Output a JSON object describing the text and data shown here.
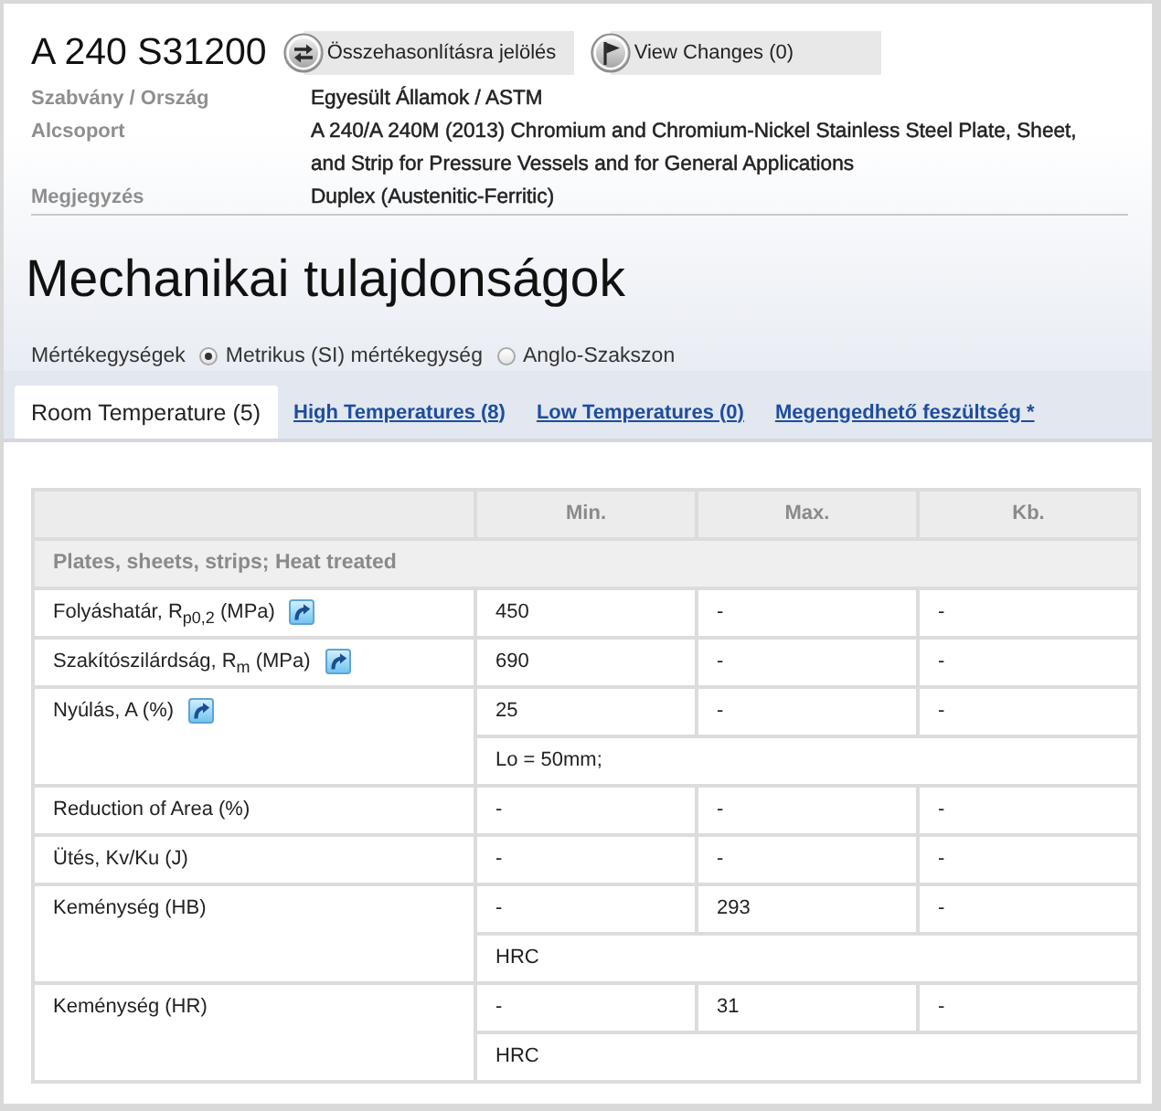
{
  "header": {
    "title": "A 240 S31200",
    "buttons": [
      {
        "kind": "compare",
        "label": "Összehasonlításra jelölés"
      },
      {
        "kind": "changes",
        "label": "View Changes (0)"
      }
    ]
  },
  "details": [
    {
      "label": "Szabvány / Ország",
      "value": "Egyesült Államok / ASTM"
    },
    {
      "label": "Alcsoport",
      "value": "A 240/A 240M (2013) Chromium and Chromium-Nickel Stainless Steel Plate, Sheet, and Strip for Pressure Vessels and for General Applications"
    },
    {
      "label": "Megjegyzés",
      "value": "Duplex (Austenitic-Ferritic)"
    }
  ],
  "section_title": "Mechanikai tulajdonságok",
  "units": {
    "label": "Mértékegységek",
    "options": [
      {
        "label": "Metrikus (SI) mértékegység",
        "selected": true
      },
      {
        "label": "Anglo-Szakszon",
        "selected": false
      }
    ]
  },
  "tabs": [
    {
      "label": "Room Temperature (5)",
      "selected": true
    },
    {
      "label": "High Temperatures (8)",
      "selected": false
    },
    {
      "label": "Low Temperatures (0)",
      "selected": false
    },
    {
      "label": "Megengedhető feszültség *",
      "selected": false
    }
  ],
  "table": {
    "columns": [
      "Min.",
      "Max.",
      "Kb."
    ],
    "group": "Plates, sheets, strips; Heat treated",
    "rows": [
      {
        "property": "Folyáshatár, R$_{p0,2}$ (MPa)",
        "link_icon": true,
        "values": [
          "450",
          "-",
          "-"
        ]
      },
      {
        "property": "Szakítószilárdság, R$_{m}$ (MPa)",
        "link_icon": true,
        "values": [
          "690",
          "-",
          "-"
        ]
      },
      {
        "property": "Nyúlás, A (%)",
        "link_icon": true,
        "values": [
          "25",
          "-",
          "-"
        ],
        "note": "Lo = 50mm;"
      },
      {
        "property": "Reduction of Area (%)",
        "link_icon": false,
        "values": [
          "-",
          "-",
          "-"
        ]
      },
      {
        "property": "Ütés, Kv/Ku (J)",
        "link_icon": false,
        "values": [
          "-",
          "-",
          "-"
        ]
      },
      {
        "property": "Keménység (HB)",
        "link_icon": false,
        "values": [
          "-",
          "293",
          "-"
        ],
        "note": "HRC"
      },
      {
        "property": "Keménység (HR)",
        "link_icon": false,
        "values": [
          "-",
          "31",
          "-"
        ],
        "note": "HRC"
      }
    ]
  }
}
